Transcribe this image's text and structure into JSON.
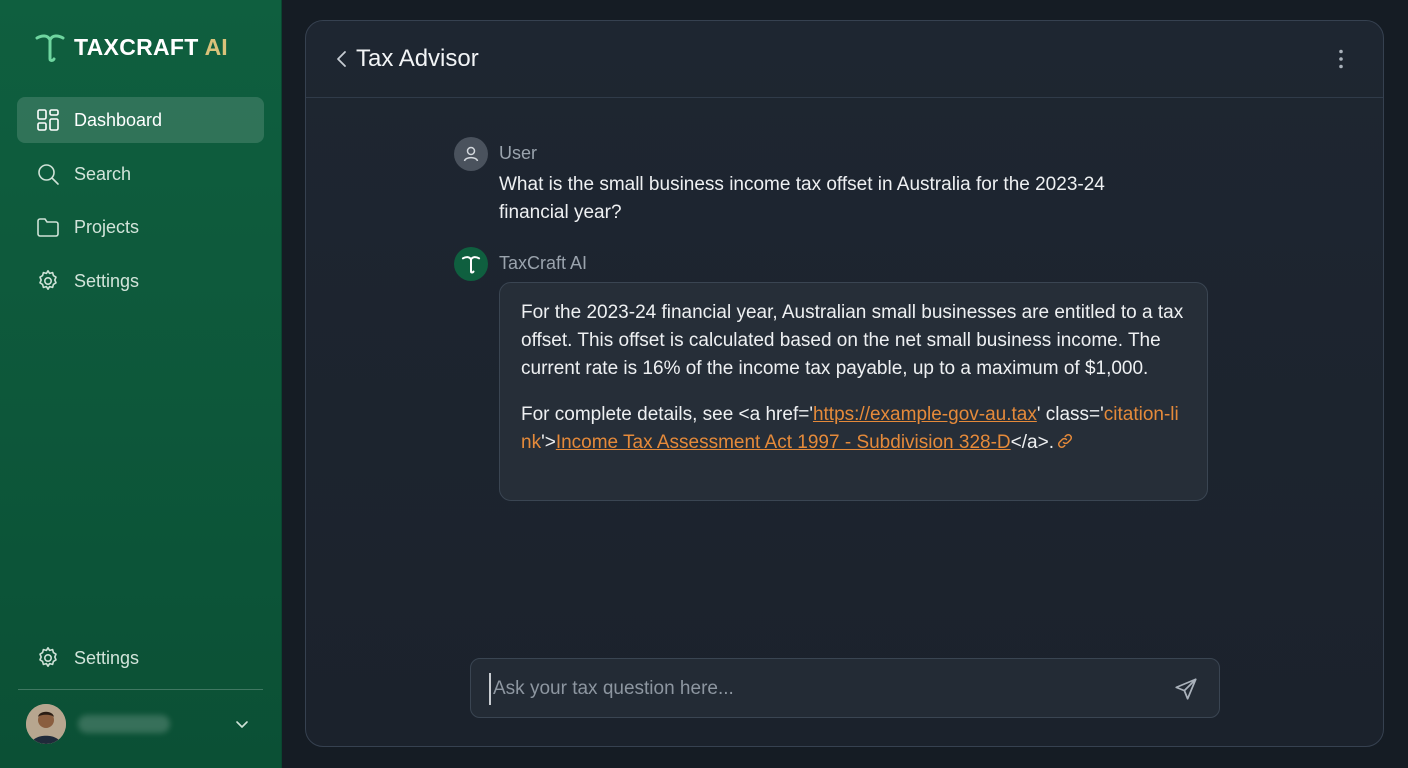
{
  "brand": {
    "name": "TAXCRAFT",
    "suffix": "AI"
  },
  "sidebar": {
    "items": [
      {
        "label": "Dashboard",
        "icon": "dashboard-icon",
        "active": true
      },
      {
        "label": "Search",
        "icon": "search-icon",
        "active": false
      },
      {
        "label": "Projects",
        "icon": "folder-icon",
        "active": false
      },
      {
        "label": "Settings",
        "icon": "gear-icon",
        "active": false
      }
    ],
    "bottom_settings_label": "Settings"
  },
  "header": {
    "title": "Tax Advisor"
  },
  "chat": {
    "user": {
      "author": "User",
      "text": "What is the small business income tax offset in Australia for the 2023-24 financial year?"
    },
    "ai": {
      "author": "TaxCraft AI",
      "paragraph1": "For the 2023-24 financial year, Australian small businesses are entitled to a tax offset. This offset is calculated based on the net small business income. The current rate is 16% of the income tax payable, up to a maximum of $1,000.",
      "cite_prefix": "For complete details, see <a href='",
      "cite_url": "https://example-gov-au.tax",
      "cite_class_mid": "' class='",
      "cite_class": "citation-link",
      "cite_close": "'>",
      "cite_link_text": "Income Tax Assessment Act 1997 - Subdivision 328-D",
      "cite_suffix": "</a>."
    }
  },
  "composer": {
    "placeholder": "Ask your tax question here..."
  },
  "colors": {
    "sidebar": "#0f5f3f",
    "accent_gold": "#d9c27a",
    "link_orange": "#e58a3a",
    "panel": "#1e2631"
  }
}
